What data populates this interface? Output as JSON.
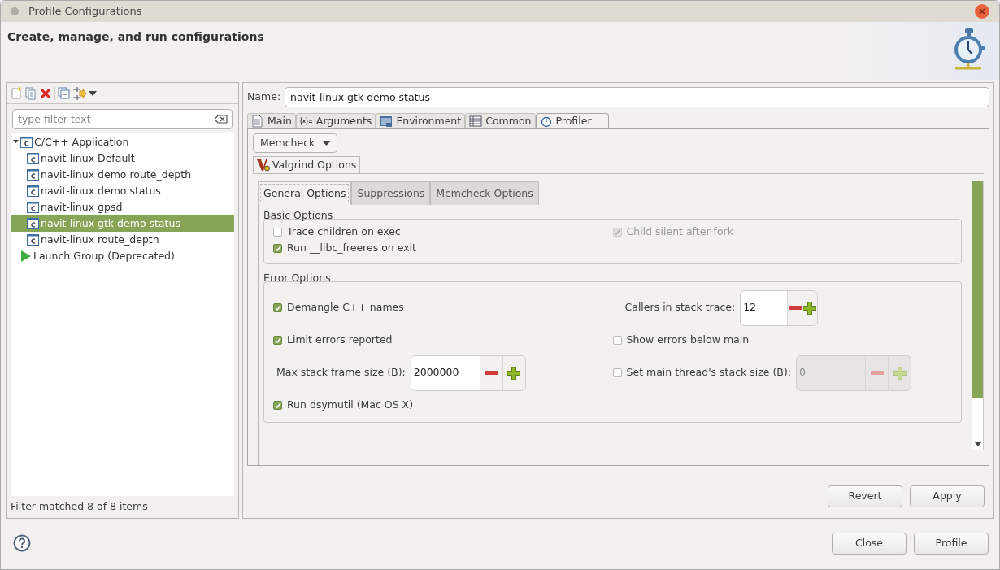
{
  "window": {
    "title": "Profile Configurations"
  },
  "header": {
    "title": "Create, manage, and run configurations"
  },
  "sidebar": {
    "filter": {
      "placeholder": "type filter text"
    },
    "tree": [
      {
        "label": "C/C++ Application",
        "kind": "category",
        "expanded": true,
        "selected": false,
        "children": [
          {
            "label": "navit-linux Default",
            "kind": "config",
            "selected": false
          },
          {
            "label": "navit-linux demo route_depth",
            "kind": "config",
            "selected": false
          },
          {
            "label": "navit-linux demo status",
            "kind": "config",
            "selected": false
          },
          {
            "label": "navit-linux gpsd",
            "kind": "config",
            "selected": false
          },
          {
            "label": "navit-linux gtk demo status",
            "kind": "config",
            "selected": true
          },
          {
            "label": "navit-linux route_depth",
            "kind": "config",
            "selected": false
          }
        ]
      },
      {
        "label": "Launch Group (Deprecated)",
        "kind": "group",
        "selected": false
      }
    ],
    "status": "Filter matched 8 of 8 items"
  },
  "editor": {
    "name_label": "Name:",
    "name_value": "navit-linux gtk demo status",
    "tabs": [
      {
        "label": "Main",
        "kind": "main",
        "selected": false
      },
      {
        "label": "Arguments",
        "kind": "arguments",
        "selected": false
      },
      {
        "label": "Environment",
        "kind": "environment",
        "selected": false
      },
      {
        "label": "Common",
        "kind": "common",
        "selected": false
      },
      {
        "label": "Profiler",
        "kind": "profiler",
        "selected": true
      }
    ],
    "tool_dropdown": "Memcheck",
    "valgrind_tab": {
      "label": "Valgrind Options",
      "selected": true
    },
    "option_tabs": [
      {
        "label": "General Options",
        "selected": true
      },
      {
        "label": "Suppressions",
        "selected": false
      },
      {
        "label": "Memcheck Options",
        "selected": false
      }
    ],
    "groups": [
      {
        "title": "Basic Options",
        "rows": [
          [
            {
              "kind": "checkbox",
              "label": "Trace children on exec",
              "checked": false,
              "disabled": false
            },
            {
              "kind": "checkbox",
              "label": "Child silent after fork",
              "checked": true,
              "disabled": true
            }
          ],
          [
            {
              "kind": "checkbox",
              "label": "Run __libc_freeres on exit",
              "checked": true,
              "disabled": false
            }
          ]
        ]
      },
      {
        "title": "Error Options",
        "rows": [
          [
            {
              "kind": "checkbox",
              "label": "Demangle C++ names",
              "checked": true,
              "disabled": false
            },
            {
              "kind": "spinner",
              "label": "Callers in stack trace:",
              "value": "12",
              "disabled": false
            }
          ],
          [
            {
              "kind": "checkbox",
              "label": "Limit errors reported",
              "checked": true,
              "disabled": false
            },
            {
              "kind": "checkbox",
              "label": "Show errors below main",
              "checked": false,
              "disabled": false
            }
          ],
          [
            {
              "kind": "spinner",
              "label": "Max stack frame size (B):",
              "value": "2000000",
              "disabled": false
            },
            {
              "kind": "checkbox_spinner",
              "label": "Set main thread's stack size (B):",
              "checked": false,
              "value": "0",
              "disabled": true
            }
          ],
          [
            {
              "kind": "checkbox",
              "label": "Run dsymutil (Mac OS X)",
              "checked": true,
              "disabled": false
            }
          ]
        ]
      }
    ],
    "buttons": [
      "Revert",
      "Apply"
    ]
  },
  "footer": {
    "buttons": [
      "Close",
      "Profile"
    ]
  }
}
